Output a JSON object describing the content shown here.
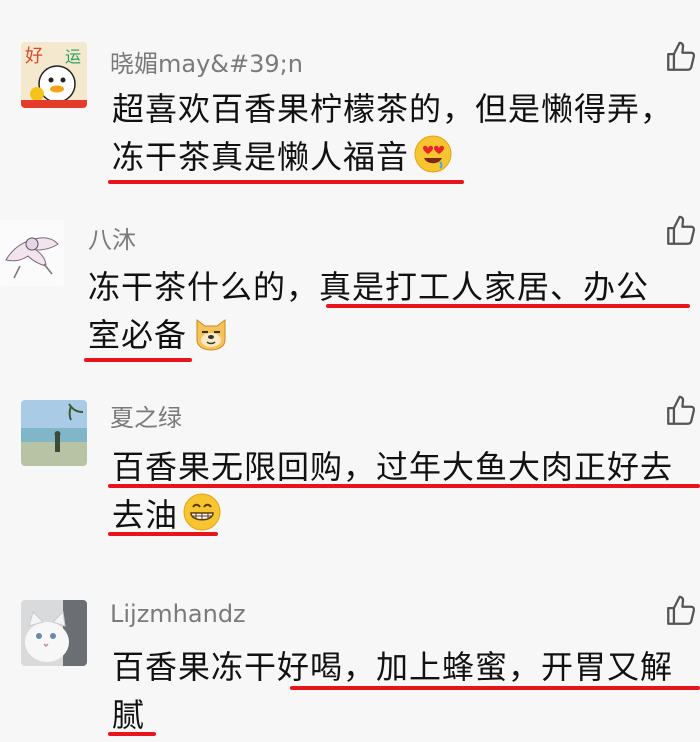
{
  "comments": [
    {
      "user": "晓媚may&#39;n",
      "avatar": "duck-avatar",
      "lines": [
        "超喜欢百香果柠檬茶的，但是懒得弄，",
        "冻干茶真是懒人福音"
      ],
      "emoji": "heart-eyes-emoji"
    },
    {
      "user": "八沐",
      "avatar": "sketch-avatar",
      "lines": [
        "冻干茶什么的，真是打工人家居、办公",
        "室必备"
      ],
      "emoji": "doge-emoji"
    },
    {
      "user": "夏之绿",
      "avatar": "beach-avatar",
      "lines": [
        "百香果无限回购，过年大鱼大肉正好去",
        "去油"
      ],
      "emoji": "grin-emoji"
    },
    {
      "user": "Lijzmhandz",
      "avatar": "cat-avatar",
      "lines": [
        "百香果冻干好喝，加上蜂蜜，开胃又解",
        "腻"
      ],
      "emoji": ""
    }
  ],
  "icons": {
    "like": "thumbs-up-icon"
  },
  "colors": {
    "underline": "#e8141c",
    "name": "#7a7a7a",
    "text": "#111111",
    "background": "#f7f7f7"
  }
}
